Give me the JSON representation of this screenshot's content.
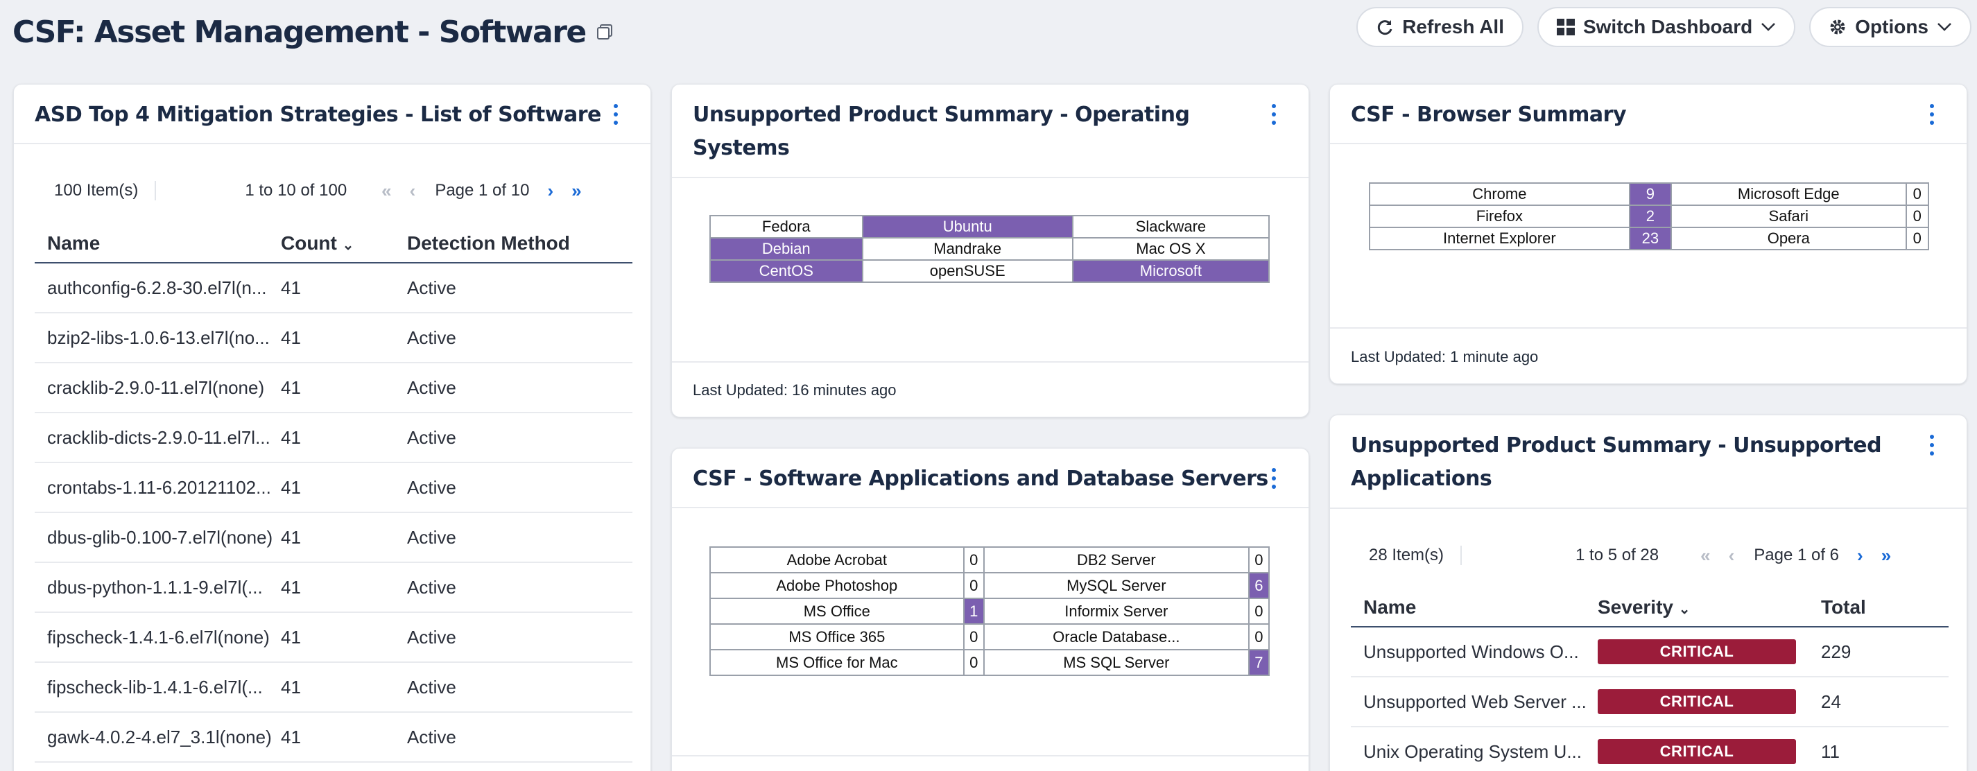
{
  "page": {
    "title": "CSF: Asset Management - Software",
    "refresh_label": "Refresh All",
    "switch_label": "Switch Dashboard",
    "options_label": "Options"
  },
  "colors": {
    "accent": "#1a6ad6",
    "highlight": "#7b5fb0",
    "critical": "#9b1c3a",
    "title": "#1b2a44"
  },
  "asd": {
    "title": "ASD Top 4 Mitigation Strategies - List of Software",
    "items_count": "100 Item(s)",
    "range": "1 to 10 of 100",
    "page": "Page 1 of 10",
    "columns": [
      "Name",
      "Count",
      "Detection Method"
    ],
    "rows": [
      [
        "authconfig-6.2.8-30.el7l(n...",
        "41",
        "Active"
      ],
      [
        "bzip2-libs-1.0.6-13.el7l(no...",
        "41",
        "Active"
      ],
      [
        "cracklib-2.9.0-11.el7l(none)",
        "41",
        "Active"
      ],
      [
        "cracklib-dicts-2.9.0-11.el7l...",
        "41",
        "Active"
      ],
      [
        "crontabs-1.11-6.20121102...",
        "41",
        "Active"
      ],
      [
        "dbus-glib-0.100-7.el7l(none)",
        "41",
        "Active"
      ],
      [
        "dbus-python-1.1.1-9.el7l(...",
        "41",
        "Active"
      ],
      [
        "fipscheck-1.4.1-6.el7l(none)",
        "41",
        "Active"
      ],
      [
        "fipscheck-lib-1.4.1-6.el7l(...",
        "41",
        "Active"
      ],
      [
        "gawk-4.0.2-4.el7_3.1l(none)",
        "41",
        "Active"
      ]
    ]
  },
  "os": {
    "title_line1": "Unsupported Product Summary - Operating",
    "title_line2": "Systems",
    "grid": [
      [
        {
          "t": "Fedora",
          "h": false
        },
        {
          "t": "Ubuntu",
          "h": true
        },
        {
          "t": "Slackware",
          "h": false
        }
      ],
      [
        {
          "t": "Debian",
          "h": true
        },
        {
          "t": "Mandrake",
          "h": false
        },
        {
          "t": "Mac OS X",
          "h": false
        }
      ],
      [
        {
          "t": "CentOS",
          "h": true
        },
        {
          "t": "openSUSE",
          "h": false
        },
        {
          "t": "Microsoft",
          "h": true
        }
      ]
    ],
    "updated": "Last Updated: 16 minutes ago"
  },
  "browser": {
    "title": "CSF - Browser Summary",
    "grid": [
      [
        {
          "t": "Chrome",
          "h": false
        },
        {
          "t": "9",
          "h": true
        },
        {
          "t": "Microsoft Edge",
          "h": false
        },
        {
          "t": "0",
          "h": false
        }
      ],
      [
        {
          "t": "Firefox",
          "h": false
        },
        {
          "t": "2",
          "h": true
        },
        {
          "t": "Safari",
          "h": false
        },
        {
          "t": "0",
          "h": false
        }
      ],
      [
        {
          "t": "Internet Explorer",
          "h": false
        },
        {
          "t": "23",
          "h": true
        },
        {
          "t": "Opera",
          "h": false
        },
        {
          "t": "0",
          "h": false
        }
      ]
    ],
    "updated": "Last Updated: 1 minute ago"
  },
  "apps": {
    "title": "CSF - Software Applications and Database Servers",
    "grid": [
      [
        {
          "t": "Adobe Acrobat",
          "h": false
        },
        {
          "t": "0",
          "h": false
        },
        {
          "t": "DB2 Server",
          "h": false
        },
        {
          "t": "0",
          "h": false
        }
      ],
      [
        {
          "t": "Adobe Photoshop",
          "h": false
        },
        {
          "t": "0",
          "h": false
        },
        {
          "t": "MySQL Server",
          "h": false
        },
        {
          "t": "6",
          "h": true
        }
      ],
      [
        {
          "t": "MS Office",
          "h": false
        },
        {
          "t": "1",
          "h": true
        },
        {
          "t": "Informix Server",
          "h": false
        },
        {
          "t": "0",
          "h": false
        }
      ],
      [
        {
          "t": "MS Office 365",
          "h": false
        },
        {
          "t": "0",
          "h": false
        },
        {
          "t": "Oracle Database...",
          "h": false
        },
        {
          "t": "0",
          "h": false
        }
      ],
      [
        {
          "t": "MS Office for Mac",
          "h": false
        },
        {
          "t": "0",
          "h": false
        },
        {
          "t": "MS SQL Server",
          "h": false
        },
        {
          "t": "7",
          "h": true
        }
      ]
    ]
  },
  "unsupported": {
    "title_line1": "Unsupported Product Summary - Unsupported",
    "title_line2": "Applications",
    "items_count": "28 Item(s)",
    "range": "1 to 5 of 28",
    "page": "Page 1 of 6",
    "columns": [
      "Name",
      "Severity",
      "Total"
    ],
    "rows": [
      [
        "Unsupported Windows O...",
        "CRITICAL",
        "229"
      ],
      [
        "Unsupported Web Server ...",
        "CRITICAL",
        "24"
      ],
      [
        "Unix Operating System U...",
        "CRITICAL",
        "11"
      ]
    ]
  }
}
